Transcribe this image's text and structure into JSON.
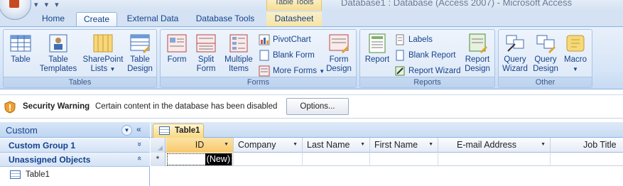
{
  "window": {
    "title": "Database1 : Database (Access 2007) - Microsoft Access",
    "contextual_group": "Table Tools",
    "qat": "▾ ▾ ▾"
  },
  "tabs": [
    {
      "label": "Home"
    },
    {
      "label": "Create"
    },
    {
      "label": "External Data"
    },
    {
      "label": "Database Tools"
    },
    {
      "label": "Datasheet"
    }
  ],
  "ribbon": {
    "groups": {
      "tables": {
        "label": "Tables",
        "buttons": [
          {
            "label": "Table"
          },
          {
            "label": "Table Templates",
            "line1": "Table",
            "line2": "Templates"
          },
          {
            "label": "SharePoint Lists",
            "line1": "SharePoint",
            "line2": "Lists"
          },
          {
            "label": "Table Design",
            "line1": "Table",
            "line2": "Design"
          }
        ]
      },
      "forms": {
        "label": "Forms",
        "buttons": [
          {
            "label": "Form"
          },
          {
            "label": "Split Form",
            "line1": "Split",
            "line2": "Form"
          },
          {
            "label": "Multiple Items",
            "line1": "Multiple",
            "line2": "Items"
          }
        ],
        "small_buttons": [
          {
            "label": "PivotChart"
          },
          {
            "label": "Blank Form"
          },
          {
            "label": "More Forms"
          }
        ],
        "design": {
          "line1": "Form",
          "line2": "Design"
        }
      },
      "reports": {
        "label": "Reports",
        "buttons": [
          {
            "label": "Report"
          }
        ],
        "small_buttons": [
          {
            "label": "Labels"
          },
          {
            "label": "Blank Report"
          },
          {
            "label": "Report Wizard"
          }
        ],
        "design": {
          "line1": "Report",
          "line2": "Design"
        }
      },
      "other": {
        "label": "Other",
        "buttons": [
          {
            "line1": "Query",
            "line2": "Wizard"
          },
          {
            "line1": "Query",
            "line2": "Design"
          },
          {
            "line1": "Macro",
            "line2": ""
          }
        ]
      }
    }
  },
  "security": {
    "title": "Security Warning",
    "message": "Certain content in the database has been disabled",
    "options_label": "Options..."
  },
  "nav": {
    "title": "Custom",
    "groups": [
      {
        "label": "Custom Group 1",
        "chevron": "»"
      },
      {
        "label": "Unassigned Objects",
        "chevron": "«"
      }
    ],
    "items": [
      {
        "label": "Table1"
      }
    ],
    "collapse": "«"
  },
  "document": {
    "tab_label": "Table1",
    "columns": [
      {
        "label": "ID"
      },
      {
        "label": "Company"
      },
      {
        "label": "Last Name"
      },
      {
        "label": "First Name"
      },
      {
        "label": "E-mail Address"
      },
      {
        "label": "Job Title"
      }
    ],
    "new_row_marker": "*",
    "new_value": "(New)"
  },
  "colors": {
    "accent": "#15428b",
    "ribbon_bg": "#d6e5f7",
    "active_tab": "#f8c86a"
  }
}
